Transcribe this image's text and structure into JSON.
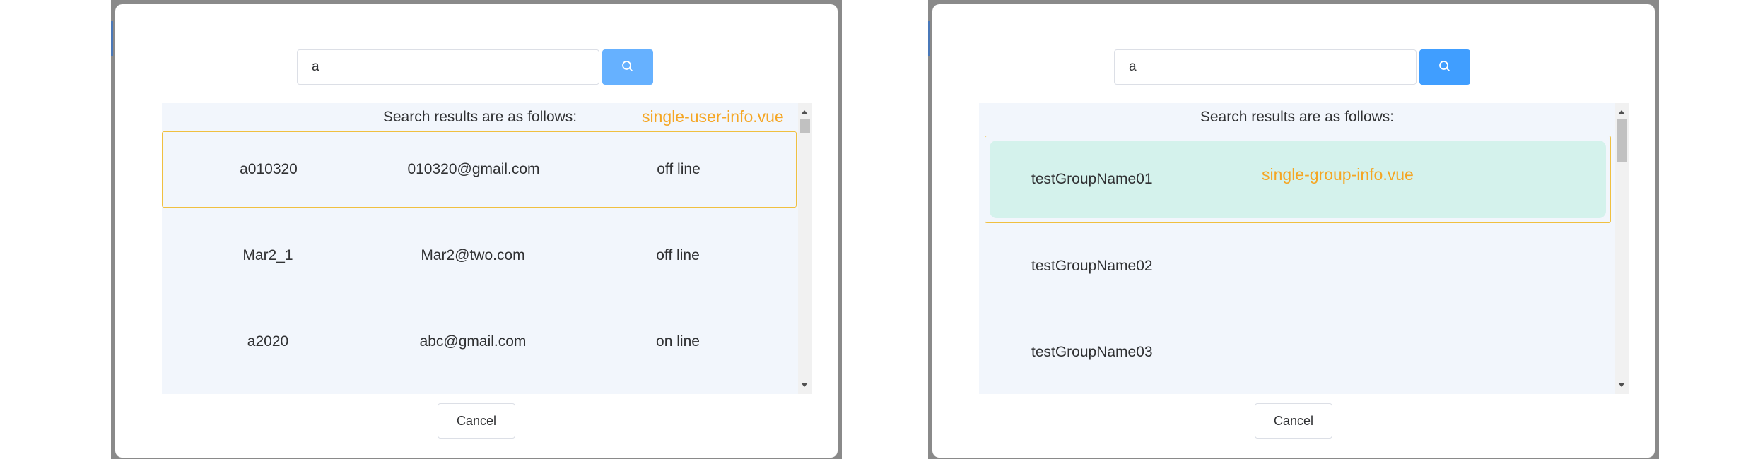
{
  "colors": {
    "primary_light": "#66b1ff",
    "primary": "#409eff",
    "annotation": "#f5a623",
    "results_bg": "#f2f6fc",
    "group_highlight": "#d4f2ec"
  },
  "user_dialog": {
    "search": {
      "value": "a",
      "button_icon": "search-icon"
    },
    "results_header": "Search results are as follows:",
    "file_label": "single-user-info.vue",
    "rows": [
      {
        "name": "a010320",
        "email": "010320@gmail.com",
        "status": "off line"
      },
      {
        "name": "Mar2_1",
        "email": "Mar2@two.com",
        "status": "off line"
      },
      {
        "name": "a2020",
        "email": "abc@gmail.com",
        "status": "on line"
      }
    ],
    "cancel_label": "Cancel"
  },
  "group_dialog": {
    "search": {
      "value": "a",
      "button_icon": "search-icon"
    },
    "results_header": "Search results are as follows:",
    "file_label": "single-group-info.vue",
    "rows": [
      {
        "name": "testGroupName01"
      },
      {
        "name": "testGroupName02"
      },
      {
        "name": "testGroupName03"
      }
    ],
    "cancel_label": "Cancel"
  }
}
